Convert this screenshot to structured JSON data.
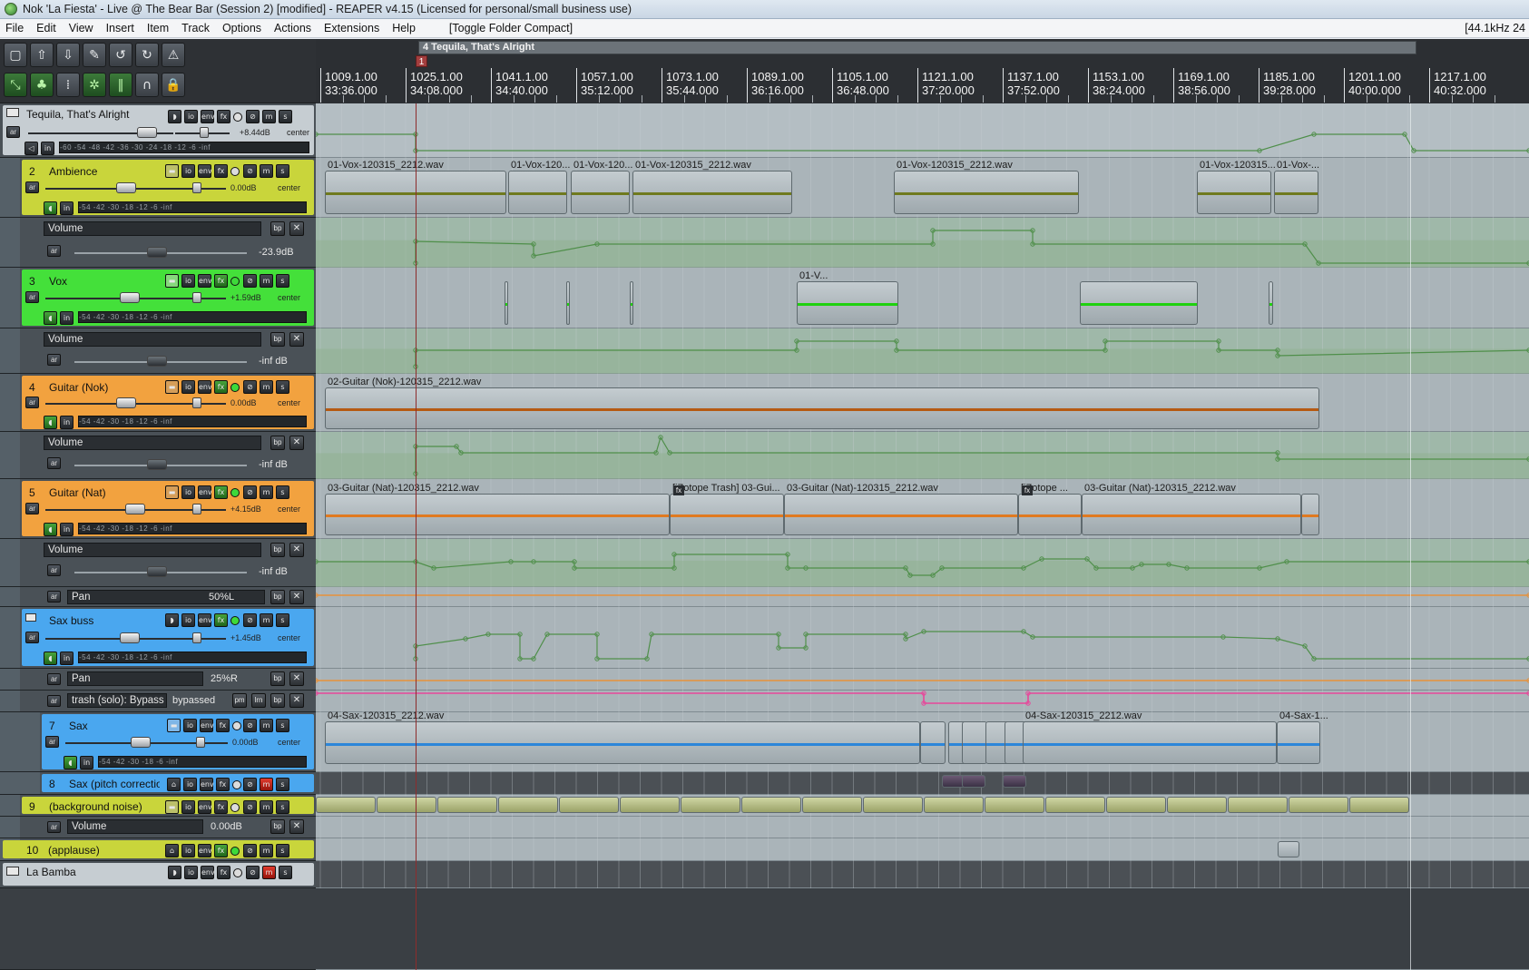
{
  "window": {
    "title": "Nok 'La Fiesta' - Live @ The Bear Bar (Session 2) [modified] - REAPER v4.15 (Licensed for personal/small business use)"
  },
  "menu": [
    "File",
    "Edit",
    "View",
    "Insert",
    "Item",
    "Track",
    "Options",
    "Actions",
    "Extensions",
    "Help"
  ],
  "toggle_folder": "[Toggle Folder Compact]",
  "rate_readout": "[44.1kHz 24",
  "toolbar": {
    "row1_icons": [
      "new-project-icon",
      "open-project-icon",
      "save-project-icon",
      "project-settings-icon",
      "undo-icon",
      "redo-icon",
      "metronome-icon"
    ],
    "row2_icons": [
      "auto-crossfade-icon",
      "grouping-icon",
      "snap-grid-icon",
      "ripple-edit-icon",
      "envelope-points-icon",
      "loop-icon",
      "lock-icon"
    ]
  },
  "ruler": {
    "region_label": "4 Tequila, That's Alright",
    "marker_label": "1",
    "measures": [
      {
        "bar": "1009.1.00",
        "time": "33:36.000"
      },
      {
        "bar": "1025.1.00",
        "time": "34:08.000"
      },
      {
        "bar": "1041.1.00",
        "time": "34:40.000"
      },
      {
        "bar": "1057.1.00",
        "time": "35:12.000"
      },
      {
        "bar": "1073.1.00",
        "time": "35:44.000"
      },
      {
        "bar": "1089.1.00",
        "time": "36:16.000"
      },
      {
        "bar": "1105.1.00",
        "time": "36:48.000"
      },
      {
        "bar": "1121.1.00",
        "time": "37:20.000"
      },
      {
        "bar": "1137.1.00",
        "time": "37:52.000"
      },
      {
        "bar": "1153.1.00",
        "time": "38:24.000"
      },
      {
        "bar": "1169.1.00",
        "time": "38:56.000"
      },
      {
        "bar": "1185.1.00",
        "time": "39:28.000"
      },
      {
        "bar": "1201.1.00",
        "time": "40:00.000"
      },
      {
        "bar": "1217.1.00",
        "time": "40:32.000"
      }
    ]
  },
  "tracks": {
    "folder": {
      "name": "Tequila, That's Alright",
      "volume": "+8.44dB",
      "pan": "center",
      "meter_scale": "-60 -54 -48 -42 -36 -30 -24 -18 -12 -6 -inf"
    },
    "t2": {
      "num": "2",
      "name": "Ambience",
      "volume": "0.00dB",
      "pan": "center",
      "meter_scale": "-54 -42 -30 -18 -12 -6 -inf",
      "color": "#c9d53b"
    },
    "t2_env": {
      "name": "Volume",
      "value": "-23.9dB"
    },
    "t3": {
      "num": "3",
      "name": "Vox",
      "volume": "+1.59dB",
      "pan": "center",
      "meter_scale": "-54 -42 -30 -18 -12 -6 -inf",
      "color": "#44e03a"
    },
    "t3_env": {
      "name": "Volume",
      "value": "-inf dB"
    },
    "t4": {
      "num": "4",
      "name": "Guitar (Nok)",
      "volume": "0.00dB",
      "pan": "center",
      "meter_scale": "-54 -42 -30 -18 -12 -6 -inf",
      "color": "#f2a23f"
    },
    "t4_env": {
      "name": "Volume",
      "value": "-inf dB"
    },
    "t5": {
      "num": "5",
      "name": "Guitar (Nat)",
      "volume": "+4.15dB",
      "pan": "center",
      "meter_scale": "-54 -42 -30 -18 -12 -6 -inf",
      "color": "#f2a23f"
    },
    "t5_env": {
      "name": "Volume",
      "value": "-inf dB"
    },
    "t5_pan": {
      "name": "Pan",
      "value": "50%L"
    },
    "t6": {
      "name": "Sax buss",
      "volume": "+1.45dB",
      "pan": "center",
      "meter_scale": "-54 -42 -30 -18 -12 -6 -inf",
      "color": "#4aa7ef"
    },
    "t6_pan": {
      "name": "Pan",
      "value": "25%R"
    },
    "t6_bypass": {
      "name": "trash (solo): Bypass",
      "value": "bypassed"
    },
    "t7": {
      "num": "7",
      "name": "Sax",
      "volume": "0.00dB",
      "pan": "center",
      "meter_scale": "-54 -42 -30 -18 -6 -inf",
      "color": "#4aa7ef"
    },
    "t8": {
      "num": "8",
      "name": "Sax (pitch correction)",
      "color": "#4aa7ef"
    },
    "t9": {
      "num": "9",
      "name": "(background noise)",
      "color": "#c9d53b"
    },
    "t9_env": {
      "name": "Volume",
      "value": "0.00dB"
    },
    "t10": {
      "num": "10",
      "name": "(applause)",
      "color": "#c9d53b"
    },
    "folder2": {
      "name": "La Bamba"
    }
  },
  "buttons": {
    "io": "io",
    "env": "env",
    "fx": "fx",
    "mute": "m",
    "solo": "s",
    "arm": "ar",
    "in": "in",
    "bp": "bp",
    "close": "✕",
    "param": "pm",
    "lrn": "lrn"
  },
  "items": {
    "amb": [
      "01-Vox-120315_2212.wav",
      "01-Vox-120...",
      "01-Vox-120...",
      "01-Vox-120315_2212.wav",
      "01-Vox-120315_2212.wav",
      "01-Vox-120315...",
      "01-Vox-..."
    ],
    "vox": "01-V...",
    "guitar_nok": "02-Guitar (Nok)-120315_2212.wav",
    "guitar_nat": [
      "03-Guitar (Nat)-120315_2212.wav",
      "[iZotope Trash] 03-Gui...",
      "03-Guitar (Nat)-120315_2212.wav",
      "[iZotope ...",
      "03-Guitar (Nat)-120315_2212.wav"
    ],
    "sax": [
      "04-Sax-120315_2212.wav",
      "04-Sax-120315_2212.wav",
      "04-Sax-1..."
    ],
    "fx_badge": "fx"
  },
  "colors": {
    "ambience": "#6f7a1e",
    "vox": "#1fd10f",
    "guitar": "#b65a13",
    "guitar_nat": "#e07a20",
    "sax": "#2d86d9",
    "envelope": "#4f8f4a",
    "pan_env": "#e8923a",
    "bypass_env": "#e7469a"
  }
}
